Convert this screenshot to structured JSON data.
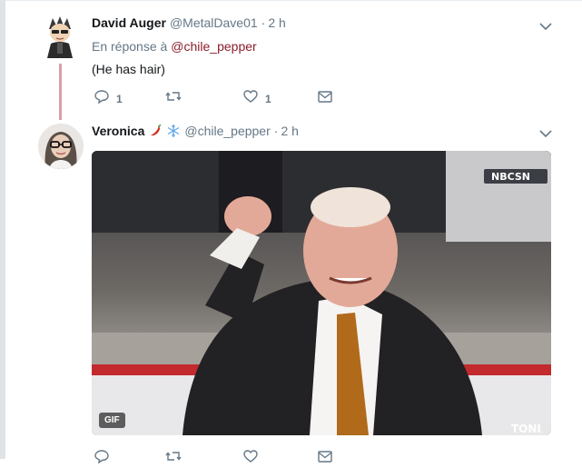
{
  "tweets": [
    {
      "name": "David Auger",
      "handle": "@MetalDave01",
      "time": "2 h",
      "reply_prefix": "En réponse à",
      "reply_to": "@chile_pepper",
      "text": "(He has hair)",
      "reply_count": "1",
      "retweet_count": "",
      "like_count": "1"
    },
    {
      "name": "Veronica",
      "name_emojis": [
        "chili-pepper",
        "snowflake"
      ],
      "handle": "@chile_pepper",
      "time": "2 h",
      "media": {
        "type": "gif",
        "badge": "GIF",
        "overlay_logo": "NBCSN",
        "corner_text": "TONI"
      }
    }
  ],
  "separator": "·",
  "colors": {
    "mention": "#8b1d2c",
    "meta": "#657786",
    "thread_line": "#d6a0a8",
    "icon": "#657786"
  }
}
